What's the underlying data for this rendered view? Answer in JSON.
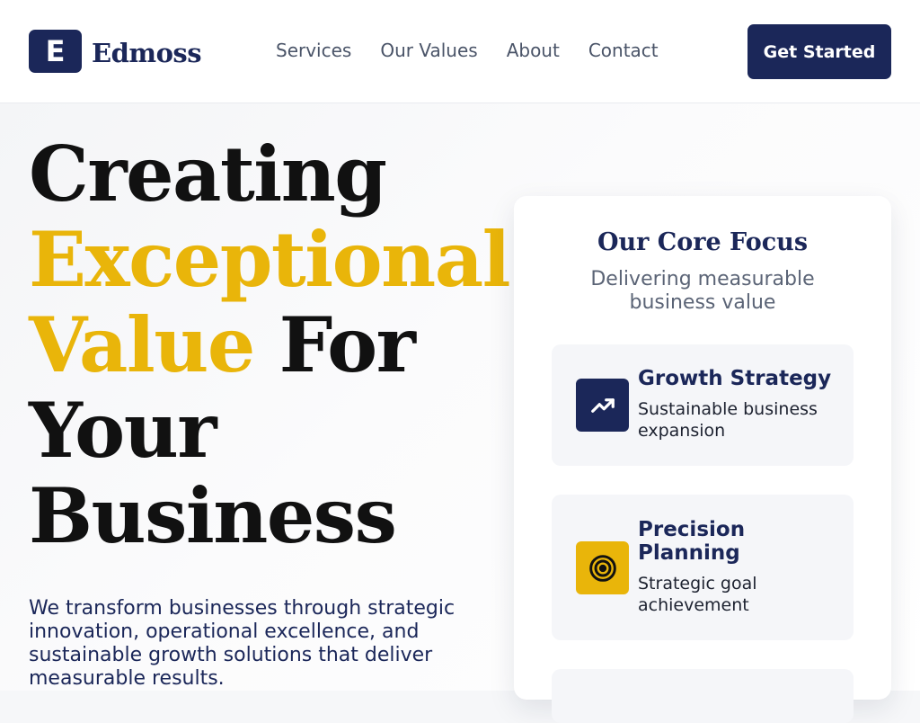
{
  "header": {
    "logo_letter": "E",
    "brand_name": "Edmoss",
    "nav": [
      "Services",
      "Our Values",
      "About",
      "Contact"
    ],
    "cta_label": "Get Started"
  },
  "hero": {
    "headline_1": "Creating",
    "headline_highlight_1": "Exceptional",
    "headline_highlight_2": "Value",
    "headline_2": "For",
    "headline_3": "Your",
    "headline_4": "Business",
    "lead": "We transform businesses through strategic innovation, operational excellence, and sustainable growth solutions that deliver measurable results."
  },
  "focus_card": {
    "title": "Our Core Focus",
    "subtitle": "Delivering measurable business value",
    "items": [
      {
        "title": "Growth Strategy",
        "desc": "Sustainable business expansion",
        "icon": "trending-up-icon",
        "icon_bg": "#1b2759"
      },
      {
        "title": "Precision Planning",
        "desc": "Strategic goal achievement",
        "icon": "target-icon",
        "icon_bg": "#e9b50a"
      },
      {
        "title": "",
        "desc": "",
        "icon": "",
        "icon_bg": ""
      }
    ]
  },
  "colors": {
    "navy": "#1b2759",
    "gold": "#e9b50a",
    "text": "#111111",
    "muted": "#5b6476"
  }
}
